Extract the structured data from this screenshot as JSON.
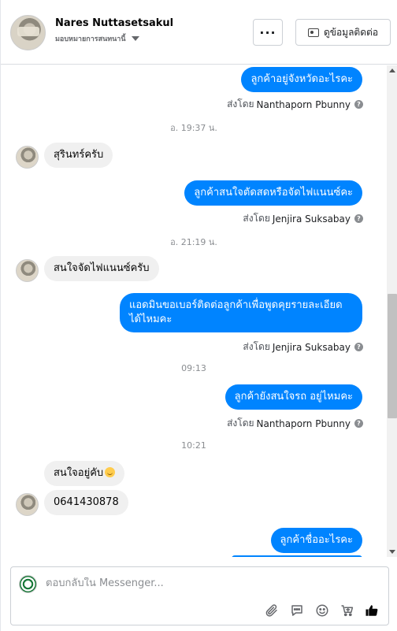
{
  "header": {
    "name": "Nares Nuttasetsakul",
    "subtitle": "มอบหมายการสนทนานี้",
    "more_label": "···",
    "contact_button_label": "ดูข้อมูลติดต่อ"
  },
  "messages": {
    "items": [
      {
        "kind": "out",
        "text": "ลูกค้าอยู่จังหวัดอะไรคะ"
      },
      {
        "kind": "sent_by",
        "prefix": "ส่งโดย",
        "who": "Nanthaporn Pbunny"
      },
      {
        "kind": "time",
        "text": "อ. 19:37 น."
      },
      {
        "kind": "in",
        "text": "สุรินทร์ครับ"
      },
      {
        "kind": "out",
        "text": "ลูกค้าสนใจตัดสดหรือจัดไฟแนนซ์คะ"
      },
      {
        "kind": "sent_by",
        "prefix": "ส่งโดย",
        "who": "Jenjira Suksabay"
      },
      {
        "kind": "time",
        "text": "อ. 21:19 น."
      },
      {
        "kind": "in",
        "text": "สนใจจัดไฟแนนซ์ครับ"
      },
      {
        "kind": "out",
        "line1": "แอดมินขอเบอร์ติดต่อลูกค้าเพื่อพูดคุยรายละเอียด",
        "line2": "ได้ไหมคะ"
      },
      {
        "kind": "sent_by",
        "prefix": "ส่งโดย",
        "who": "Jenjira Suksabay"
      },
      {
        "kind": "time",
        "text": "09:13"
      },
      {
        "kind": "out",
        "text": "ลูกค้ายังสนใจรถ อยู่ไหมคะ"
      },
      {
        "kind": "sent_by",
        "prefix": "ส่งโดย",
        "who": "Nanthaporn Pbunny"
      },
      {
        "kind": "time",
        "text": "10:21"
      },
      {
        "kind": "in",
        "text": "สนใจอยู่คับ",
        "emoji": "smiling-face-emoji"
      },
      {
        "kind": "in",
        "text": "0641430878"
      },
      {
        "kind": "out",
        "text": "ลูกค้าชื่ออะไรคะ"
      }
    ]
  },
  "composer": {
    "placeholder": "ตอบกลับใน Messenger...",
    "tools": [
      "paperclip-icon",
      "speech-bubble-icon",
      "smiley-icon",
      "cart-icon",
      "thumbs-up-icon"
    ]
  },
  "colors": {
    "accent": "#0084ff",
    "incoming_bubble": "#f0f0f0"
  }
}
